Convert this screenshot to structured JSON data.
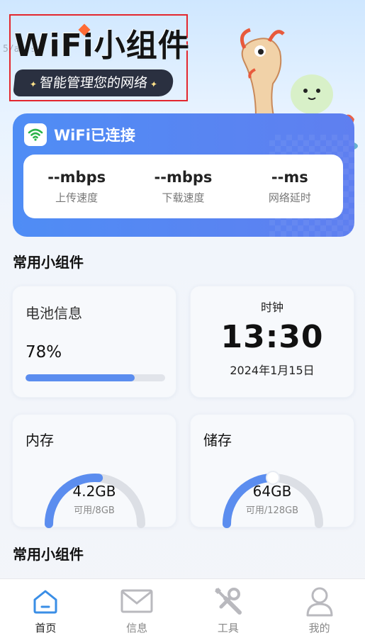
{
  "hero": {
    "title": "WiFi小组件",
    "subtitle": "智能管理您的网络",
    "watermark": "5/af09"
  },
  "wifi": {
    "status": "WiFi已连接",
    "stats": [
      {
        "value": "--mbps",
        "label": "上传速度"
      },
      {
        "value": "--mbps",
        "label": "下载速度"
      },
      {
        "value": "--ms",
        "label": "网络延时"
      }
    ]
  },
  "sections": {
    "common_widgets_1": "常用小组件",
    "common_widgets_2": "常用小组件"
  },
  "battery": {
    "label": "电池信息",
    "percent_text": "78%",
    "level": 0.78
  },
  "clock": {
    "label": "时钟",
    "time": "13:30",
    "date": "2024年1月15日"
  },
  "memory": {
    "label": "内存",
    "value": "4.2GB",
    "sub": "可用/8GB",
    "fraction": 0.525
  },
  "storage": {
    "label": "储存",
    "value": "64GB",
    "sub": "可用/128GB",
    "fraction": 0.5
  },
  "tabbar": [
    {
      "label": "首页",
      "icon": "home-icon",
      "active": true
    },
    {
      "label": "信息",
      "icon": "mail-icon",
      "active": false
    },
    {
      "label": "工具",
      "icon": "wrench-icon",
      "active": false
    },
    {
      "label": "我的",
      "icon": "user-icon",
      "active": false
    }
  ],
  "colors": {
    "accent": "#4f8df5",
    "gauge_track": "#dcdfe5",
    "wifi_green": "#2bb34a"
  }
}
